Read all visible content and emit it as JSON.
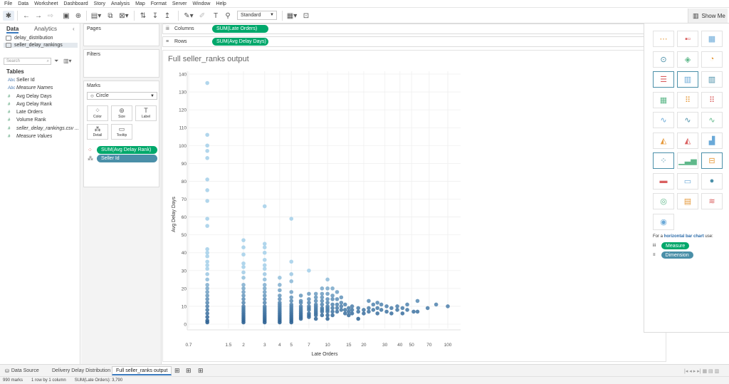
{
  "menu": [
    "File",
    "Data",
    "Worksheet",
    "Dashboard",
    "Story",
    "Analysis",
    "Map",
    "Format",
    "Server",
    "Window",
    "Help"
  ],
  "toolbar": {
    "fit": "Standard",
    "show_me": "Show Me"
  },
  "data_pane": {
    "tabs": [
      "Data",
      "Analytics"
    ],
    "sources": [
      "delay_distribution",
      "seller_delay_rankings"
    ],
    "search_placeholder": "Search",
    "tables_label": "Tables",
    "fields": [
      {
        "type": "Abc",
        "name": "Seller Id"
      },
      {
        "type": "Abc",
        "name": "Measure Names"
      },
      {
        "type": "#",
        "name": "Avg Delay Days"
      },
      {
        "type": "#",
        "name": "Avg Delay Rank"
      },
      {
        "type": "#",
        "name": "Late Orders"
      },
      {
        "type": "#",
        "name": "Volume Rank"
      },
      {
        "type": "#",
        "name": "seller_delay_rankings.csv ..."
      },
      {
        "type": "#",
        "name": "Measure Values"
      }
    ]
  },
  "cards": {
    "pages": "Pages",
    "filters": "Filters",
    "marks": "Marks",
    "mark_type": "Circle",
    "mark_buttons": [
      "Color",
      "Size",
      "Label",
      "Detail",
      "Tooltip"
    ],
    "color_pill": "SUM(Avg Delay Rank)",
    "detail_pill": "Seller Id"
  },
  "shelves": {
    "columns_label": "Columns",
    "columns_pill": "SUM(Late Orders)",
    "rows_label": "Rows",
    "rows_pill": "SUM(Avg Delay Days)"
  },
  "viz": {
    "title": "Full seller_ranks output"
  },
  "colors": {
    "pill_green": "#00a86b",
    "pill_blue": "#4a8fa8",
    "mark_light": "#a9d2ea",
    "mark_dark": "#2b5f91"
  },
  "chart_data": {
    "type": "scatter",
    "title": "",
    "xlabel": "Late Orders",
    "ylabel": "Avg Delay Days",
    "x_scale": "log",
    "xlim": [
      0.7,
      100
    ],
    "ylim": [
      0,
      140
    ],
    "x_ticks": [
      "0.7",
      "1.5",
      "2",
      "3",
      "4",
      "5",
      "7",
      "10",
      "15",
      "20",
      "30",
      "40",
      "50",
      "70",
      "100"
    ],
    "y_ticks": [
      0,
      10,
      20,
      30,
      40,
      50,
      60,
      70,
      80,
      90,
      100,
      110,
      120,
      130,
      140
    ],
    "color_encoding": "SUM(Avg Delay Rank)",
    "columns": [
      {
        "x": 1,
        "values": [
          135,
          106,
          100,
          97,
          93,
          81,
          75,
          69,
          59,
          55,
          42,
          40,
          38,
          35,
          33,
          31,
          28,
          25,
          22,
          20,
          18,
          16,
          14,
          12,
          10,
          8,
          6,
          4,
          2,
          1
        ]
      },
      {
        "x": 2,
        "values": [
          47,
          43,
          39,
          34,
          32,
          29,
          26,
          22,
          20,
          18,
          16,
          14,
          12,
          10,
          9,
          8,
          7,
          6,
          5,
          4,
          3,
          2,
          1
        ]
      },
      {
        "x": 3,
        "values": [
          66,
          45,
          43,
          40,
          36,
          33,
          31,
          28,
          25,
          22,
          20,
          18,
          16,
          14,
          12,
          10,
          9,
          8,
          7,
          6,
          5,
          4,
          3,
          2,
          1
        ]
      },
      {
        "x": 4,
        "values": [
          26,
          22,
          19,
          16,
          14,
          12,
          11,
          10,
          9,
          8,
          7,
          6,
          5,
          4,
          3,
          2,
          1
        ]
      },
      {
        "x": 5,
        "values": [
          59,
          35,
          28,
          24,
          18,
          15,
          13,
          11,
          10,
          9,
          8,
          7,
          6,
          5,
          4,
          3,
          2,
          1
        ]
      },
      {
        "x": 6,
        "values": [
          16,
          13,
          12,
          10,
          9,
          8,
          7,
          6,
          5,
          4,
          3
        ]
      },
      {
        "x": 7,
        "values": [
          30,
          17,
          14,
          12,
          10,
          9,
          8,
          6,
          5,
          4
        ]
      },
      {
        "x": 8,
        "values": [
          17,
          15,
          13,
          11,
          10,
          9,
          8,
          7,
          6,
          5,
          3
        ]
      },
      {
        "x": 9,
        "values": [
          20,
          17,
          15,
          13,
          11,
          9,
          8,
          7,
          5
        ]
      },
      {
        "x": 10,
        "values": [
          25,
          20,
          17,
          14,
          12,
          10,
          9,
          8,
          7,
          5,
          3
        ]
      },
      {
        "x": 11,
        "values": [
          20,
          16,
          14,
          11,
          9,
          7,
          5
        ]
      },
      {
        "x": 12,
        "values": [
          18,
          14,
          11,
          9,
          7
        ]
      },
      {
        "x": 13,
        "values": [
          15,
          12,
          10,
          8
        ]
      },
      {
        "x": 14,
        "values": [
          11,
          8,
          6
        ]
      },
      {
        "x": 15,
        "values": [
          9,
          7,
          5
        ]
      },
      {
        "x": 16,
        "values": [
          10,
          8,
          6
        ]
      },
      {
        "x": 18,
        "values": [
          9,
          7,
          3
        ]
      },
      {
        "x": 20,
        "values": [
          8,
          6
        ]
      },
      {
        "x": 22,
        "values": [
          13,
          9,
          7
        ]
      },
      {
        "x": 24,
        "values": [
          11,
          8
        ]
      },
      {
        "x": 26,
        "values": [
          12,
          9,
          6
        ]
      },
      {
        "x": 28,
        "values": [
          11,
          8
        ]
      },
      {
        "x": 31,
        "values": [
          10,
          7
        ]
      },
      {
        "x": 34,
        "values": [
          9,
          6
        ]
      },
      {
        "x": 38,
        "values": [
          10,
          8
        ]
      },
      {
        "x": 42,
        "values": [
          9,
          6
        ]
      },
      {
        "x": 46,
        "values": [
          11,
          8
        ]
      },
      {
        "x": 52,
        "values": [
          7
        ]
      },
      {
        "x": 56,
        "values": [
          13,
          7
        ]
      },
      {
        "x": 68,
        "values": [
          9
        ]
      },
      {
        "x": 80,
        "values": [
          11
        ]
      },
      {
        "x": 100,
        "values": [
          10
        ]
      }
    ]
  },
  "show_me": {
    "hint_prefix": "For a",
    "hint_chart": "horizontal bar chart",
    "hint_suffix": "use:",
    "measure_label": "Measure",
    "dimension_label": "Dimension"
  },
  "bottom_tabs": [
    "Data Source",
    "Delivery Delay Distribution",
    "Full seller_ranks output"
  ],
  "status": [
    "990 marks",
    "1 row by 1 column",
    "SUM(Late Orders): 3,790"
  ]
}
